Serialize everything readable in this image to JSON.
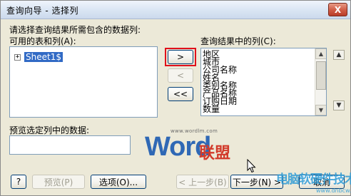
{
  "window": {
    "title": "查询向导 - 选择列",
    "close_label": "X"
  },
  "instruction": "请选择查询结果所需包含的数据列:",
  "available": {
    "label": "可用的表和列(A):",
    "items": [
      {
        "expander": "+",
        "label": "Sheet1$"
      }
    ]
  },
  "results": {
    "label": "查询结果中的列(C):",
    "items": [
      "地区",
      "城市",
      "公司名称",
      "姓名",
      "类别名称",
      "产品名称",
      "订购日期",
      "数量"
    ]
  },
  "move_buttons": {
    "add": ">",
    "remove": "<",
    "remove_all": "<<"
  },
  "reorder": {
    "up": "▲",
    "down": "▼"
  },
  "preview": {
    "label": "预览选定列中的数据:"
  },
  "footer": {
    "help": "?",
    "preview": "预览(P)",
    "options": "选项(O)...",
    "back": "< 上一步(B)",
    "next": "下一步(N) >",
    "cancel": "取消"
  },
  "watermarks": {
    "word_logo": "Word联盟",
    "word_url": "www.wordlm.com",
    "site_logo": "电脑软硬件技术网",
    "site_url": "www.dnbcw.com"
  },
  "colors": {
    "selection": "#316ac5",
    "highlight_box": "#e0101a",
    "word_blue": "#2f68b5",
    "word_red": "#d23a2a",
    "site_blue": "#2b9ad6"
  }
}
